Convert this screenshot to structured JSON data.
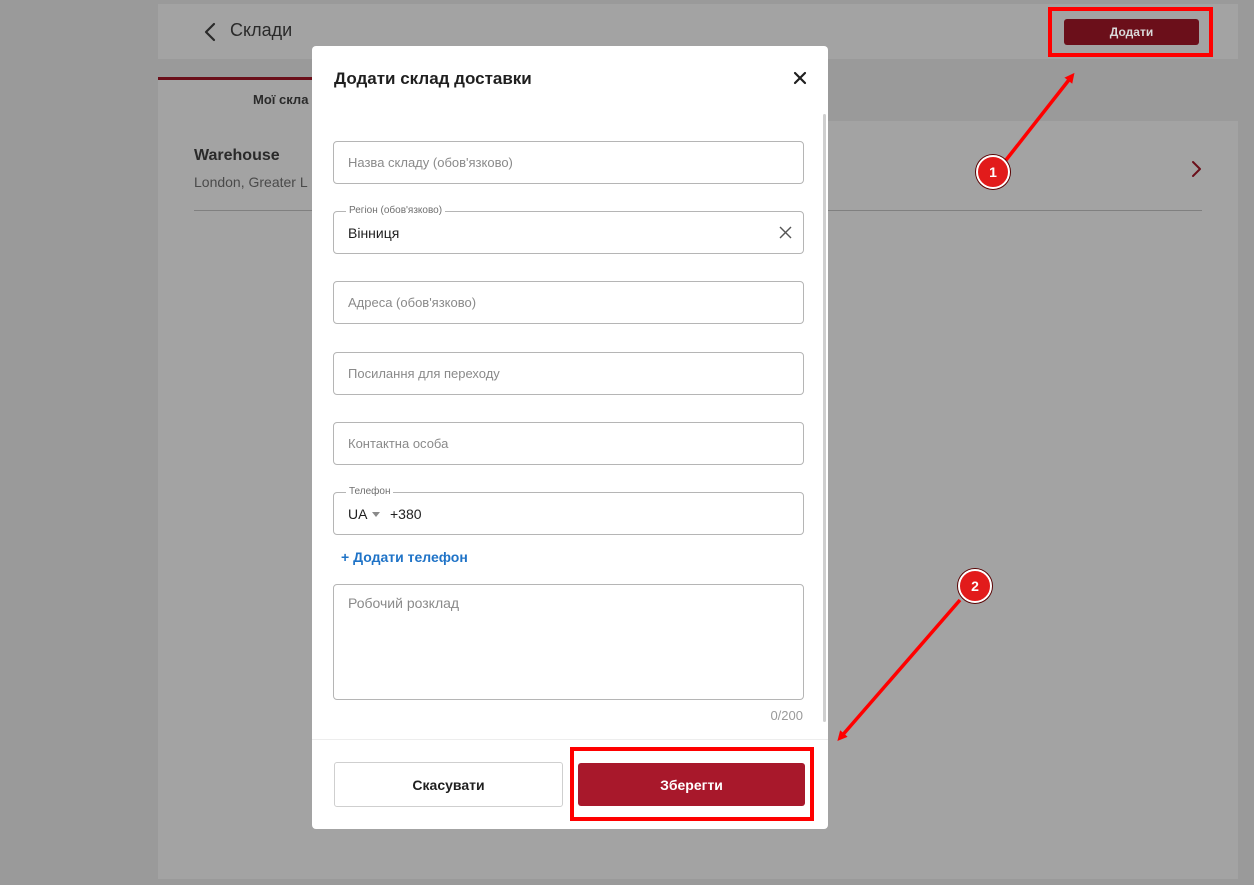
{
  "background": {
    "header": {
      "back_label": "Склади",
      "add_button": "Додати"
    },
    "tabs": [
      {
        "label": "Мої скла"
      }
    ],
    "warehouse": {
      "name": "Warehouse",
      "address": "London, Greater L"
    }
  },
  "modal": {
    "title": "Додати склад доставки",
    "fields": {
      "name": {
        "placeholder": "Назва складу (обов'язково)",
        "value": ""
      },
      "region": {
        "label": "Регіон (обов'язково)",
        "value": "Вінниця"
      },
      "address": {
        "placeholder": "Адреса (обов'язково)",
        "value": ""
      },
      "link": {
        "placeholder": "Посилання для переходу",
        "value": ""
      },
      "contact": {
        "placeholder": "Контактна особа",
        "value": ""
      },
      "phone": {
        "label": "Телефон",
        "country": "UA",
        "code": "+380"
      }
    },
    "add_phone": "+ Додати телефон",
    "schedule": {
      "placeholder": "Робочий розклад",
      "counter": "0/200"
    },
    "buttons": {
      "cancel": "Скасувати",
      "save": "Зберегти"
    }
  },
  "annotations": {
    "badges": [
      "1",
      "2"
    ],
    "color": "#ff0000"
  },
  "colors": {
    "brand": "#a8182b",
    "link": "#1f73c7"
  }
}
